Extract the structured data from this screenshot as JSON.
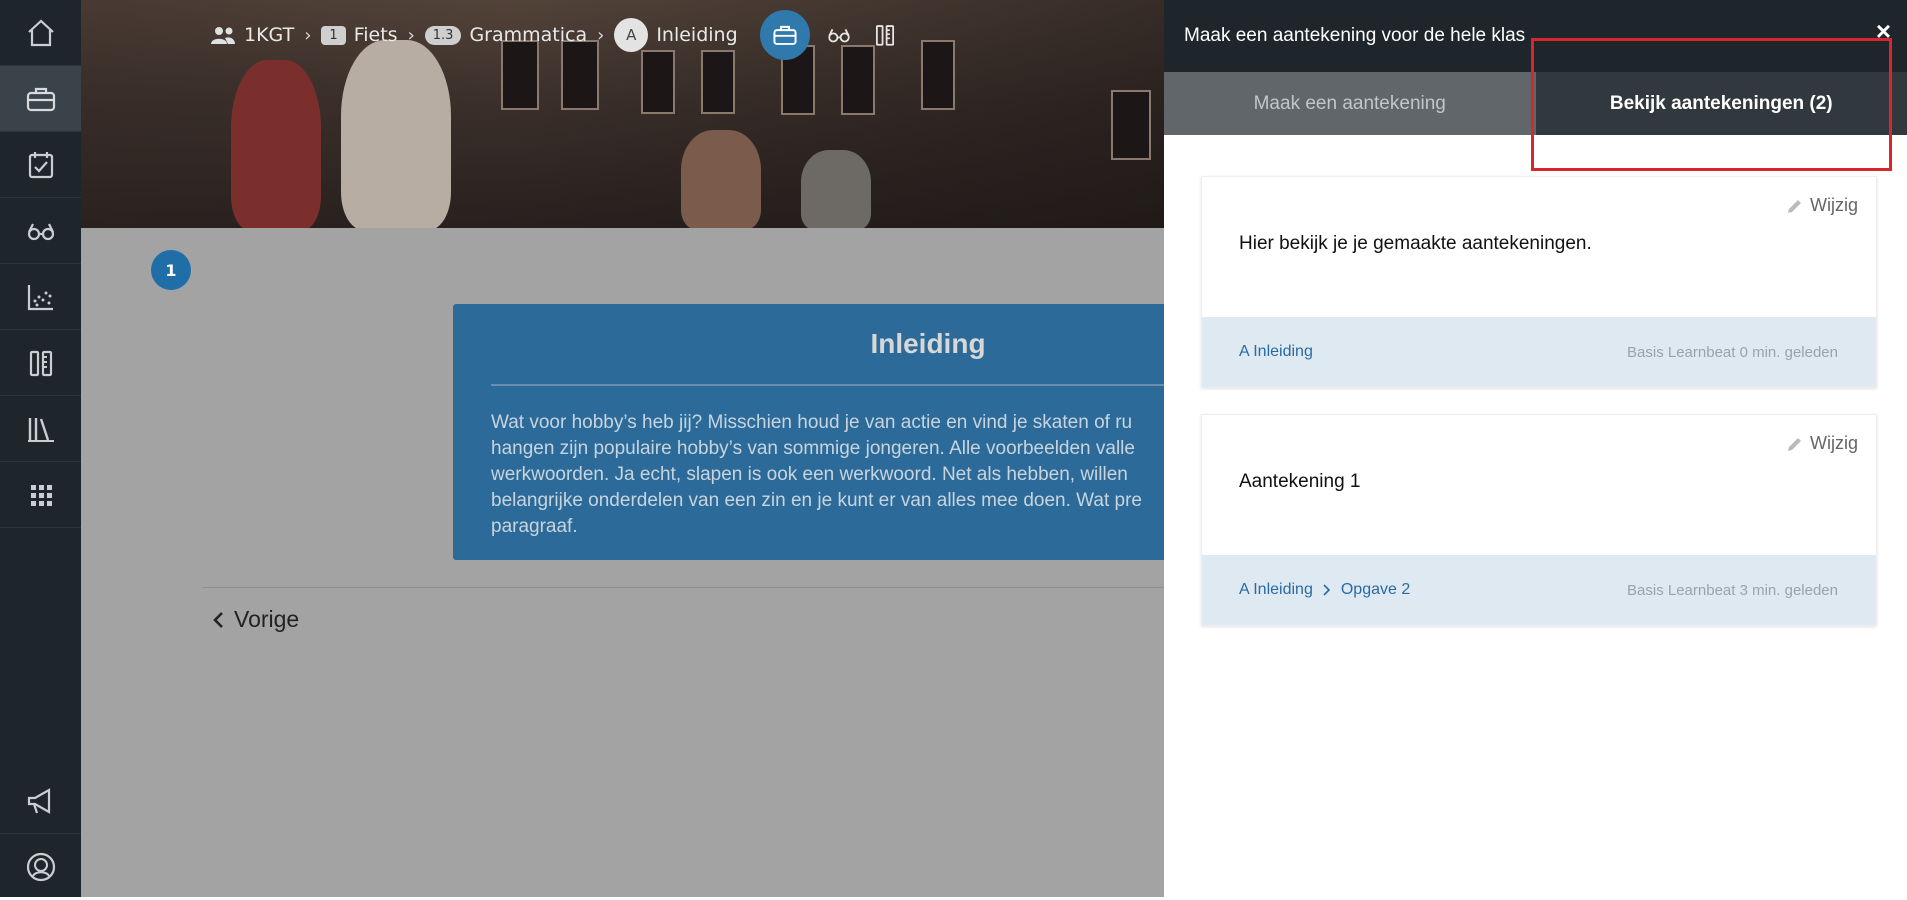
{
  "sidebar": {
    "items": [
      {
        "icon": "home-icon"
      },
      {
        "icon": "briefcase-icon",
        "active": true
      },
      {
        "icon": "calendar-check-icon"
      },
      {
        "icon": "glasses-icon"
      },
      {
        "icon": "scatter-chart-icon"
      },
      {
        "icon": "tools-icon"
      },
      {
        "icon": "library-icon"
      },
      {
        "icon": "apps-grid-icon"
      }
    ],
    "bottom": [
      {
        "icon": "megaphone-icon"
      },
      {
        "icon": "user-avatar-icon"
      }
    ]
  },
  "breadcrumb": {
    "group": "1KGT",
    "chapter_num": "1",
    "chapter": "Fiets",
    "section_num": "1.3",
    "section": "Grammatica",
    "lesson_letter": "A",
    "lesson": "Inleiding"
  },
  "main": {
    "step_number": "1",
    "card_title": "Inleiding",
    "card_lines": [
      "Wat voor hobby’s heb jij? Misschien houd je van actie en vind je skaten of ru",
      "hangen zijn populaire hobby’s van sommige jongeren. Alle voorbeelden valle",
      "werkwoorden. Ja echt, slapen is ook een werkwoord. Net als hebben, willen",
      "belangrijke onderdelen van een zin en je kunt er van alles mee doen. Wat pre",
      "paragraaf."
    ],
    "prev_label": "Vorige"
  },
  "panel": {
    "title": "Maak een aantekening voor de hele klas",
    "close": "×",
    "tab_make": "Maak een aantekening",
    "tab_view": "Bekijk aantekeningen (2)",
    "notes": [
      {
        "edit_label": "Wijzig",
        "text": "Hier bekijk je je gemaakte aantekeningen.",
        "link1": "A Inleiding",
        "meta": "Basis Learnbeat 0 min. geleden"
      },
      {
        "edit_label": "Wijzig",
        "text": "Aantekening 1",
        "link1": "A Inleiding",
        "link2": "Opgave 2",
        "meta": "Basis Learnbeat 3 min. geleden"
      }
    ]
  },
  "colors": {
    "sidebar_bg": "#1f262b",
    "accent_blue": "#2f79ad",
    "card_blue": "#2c6b99",
    "highlight_red": "#d8262f"
  }
}
